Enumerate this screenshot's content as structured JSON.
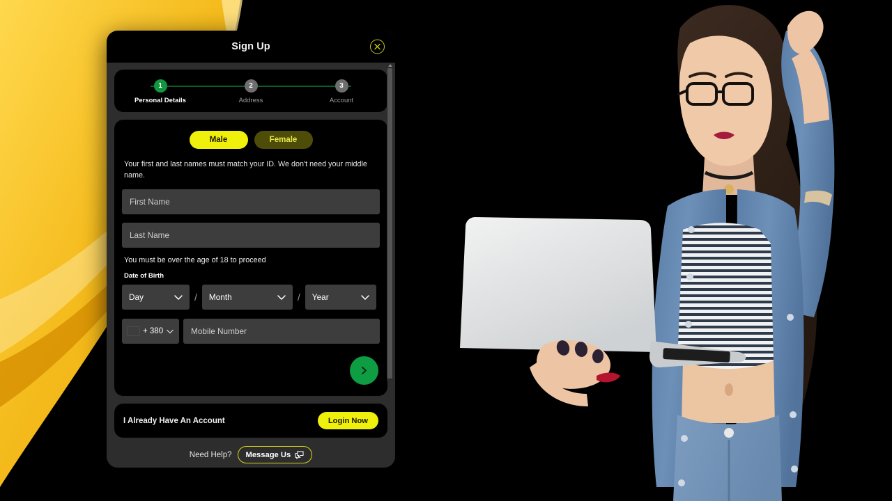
{
  "modal": {
    "title": "Sign Up",
    "close_icon": "close-circle-icon"
  },
  "stepper": {
    "steps": [
      {
        "number": "1",
        "label": "Personal Details",
        "state": "active"
      },
      {
        "number": "2",
        "label": "Address",
        "state": "inactive"
      },
      {
        "number": "3",
        "label": "Account",
        "state": "inactive"
      }
    ]
  },
  "form": {
    "gender": {
      "male_label": "Male",
      "female_label": "Female",
      "selected": "Male"
    },
    "name_helper": "Your first and last names must match your ID. We don't need your middle name.",
    "first_name": {
      "placeholder": "First Name",
      "value": ""
    },
    "last_name": {
      "placeholder": "Last Name",
      "value": ""
    },
    "age_note": "You must be over the age of 18 to proceed",
    "dob": {
      "label": "Date of Birth",
      "day": "Day",
      "month": "Month",
      "year": "Year",
      "separator": "/"
    },
    "phone": {
      "country_flag": "ukraine-flag-icon",
      "dial_code": "+ 380",
      "placeholder": "Mobile Number",
      "value": ""
    },
    "next_icon": "chevron-right-icon"
  },
  "account": {
    "prompt": "I Already Have An Account",
    "login_label": "Login Now"
  },
  "help": {
    "text": "Need Help?",
    "button_label": "Message Us",
    "button_icon": "chat-bubble-icon"
  },
  "colors": {
    "accent_yellow": "#f0f00d",
    "accent_yellow_dim": "#4d4d09",
    "green_active": "#12963f",
    "green_button": "#0f9d44",
    "modal_bg": "#2d2d2d",
    "card_bg": "#000000",
    "field_bg": "#3d3d3d",
    "gold_bg": "#f2b705",
    "page_bg": "#000000"
  }
}
